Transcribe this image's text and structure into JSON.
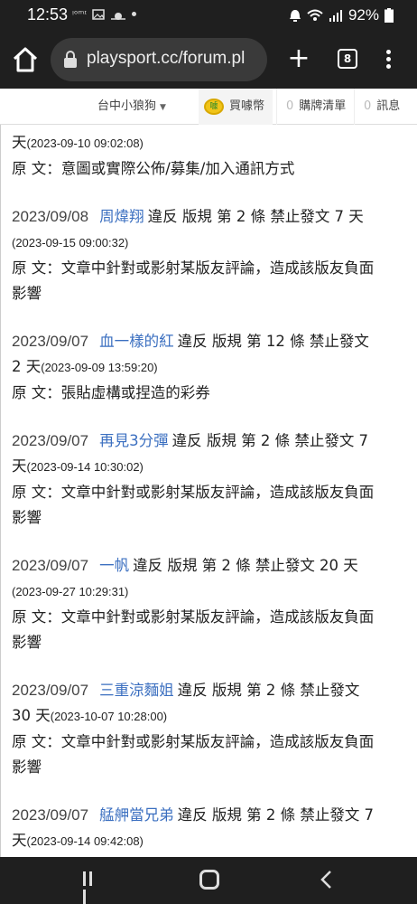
{
  "status_bar": {
    "time": "12:53",
    "left_icons": "ᵎᵒᵐᶦ",
    "battery": "92%"
  },
  "browser": {
    "url": "playsport.cc/forum.pl",
    "tab_count": "8"
  },
  "site_header": {
    "user_name": "台中小狼狗",
    "coin_label": "買噱幣",
    "coin_icon_text": "噱",
    "cart_count": "0",
    "cart_label": "購牌清單",
    "msg_count": "0",
    "msg_label": "訊息"
  },
  "partial_entry": {
    "line1_prefix": "天",
    "line1_ts": "(2023-09-10 09:02:08)",
    "reason_label": "原 文：",
    "reason": "意圖或實際公佈/募集/加入通訊方式"
  },
  "entries": [
    {
      "date": "2023/09/08",
      "user": "周煒翔",
      "text": "違反 版規 第 2 條 禁止發文 7 天",
      "ts": "(2023-09-15 09:00:32)",
      "reason_label": "原 文：",
      "reason1": "文章中針對或影射某版友評論，造成該版友負面",
      "reason2": "影響"
    },
    {
      "date": "2023/09/07",
      "user": "血一樣的紅",
      "text": "違反 版規 第 12 條 禁止發文",
      "text2": "2 天",
      "ts": "(2023-09-09 13:59:20)",
      "reason_label": "原 文：",
      "reason1": "張貼虛構或捏造的彩券"
    },
    {
      "date": "2023/09/07",
      "user": "再見3分彈",
      "text": "違反 版規 第 2 條 禁止發文 7",
      "text2": "天",
      "ts": "(2023-09-14 10:30:02)",
      "reason_label": "原 文：",
      "reason1": "文章中針對或影射某版友評論，造成該版友負面",
      "reason2": "影響"
    },
    {
      "date": "2023/09/07",
      "user": "一帆",
      "text": "違反 版規 第 2 條 禁止發文 20 天",
      "ts": "(2023-09-27 10:29:31)",
      "reason_label": "原 文：",
      "reason1": "文章中針對或影射某版友評論，造成該版友負面",
      "reason2": "影響"
    },
    {
      "date": "2023/09/07",
      "user": "三重涼麵姐",
      "text": "違反 版規 第 2 條 禁止發文",
      "text2": "30 天",
      "ts": "(2023-10-07 10:28:00)",
      "reason_label": "原 文：",
      "reason1": "文章中針對或影射某版友評論，造成該版友負面",
      "reason2": "影響"
    },
    {
      "date": "2023/09/07",
      "user": "艋舺當兄弟",
      "text": "違反 版規 第 2 條 禁止發文 7",
      "text2": "天",
      "ts": "(2023-09-14 09:42:08)"
    }
  ]
}
